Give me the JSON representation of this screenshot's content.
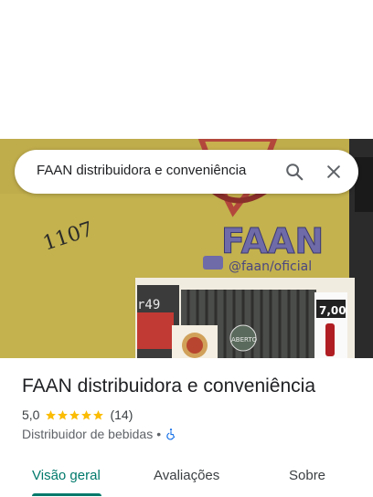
{
  "search": {
    "query": "FAAN distribuidora e conveniência",
    "search_icon": "search-icon",
    "close_icon": "close-icon"
  },
  "photo": {
    "store_name": "FAAN",
    "handle": "@faan/oficial",
    "street_number": "1107",
    "price_sign": "7,00",
    "side_sign": "r49",
    "open_sign": "ABERTO"
  },
  "place": {
    "title": "FAAN distribuidora e conveniência",
    "rating": "5,0",
    "stars": 5,
    "review_count": "(14)",
    "category": "Distribuidor de bebidas",
    "separator": "•",
    "accessibility_icon": "wheelchair-icon"
  },
  "tabs": [
    {
      "label": "Visão geral",
      "active": true
    },
    {
      "label": "Avaliações",
      "active": false
    },
    {
      "label": "Sobre",
      "active": false
    }
  ],
  "colors": {
    "accent": "#00796b",
    "star": "#fbbc04",
    "accessibility": "#1a73e8"
  }
}
